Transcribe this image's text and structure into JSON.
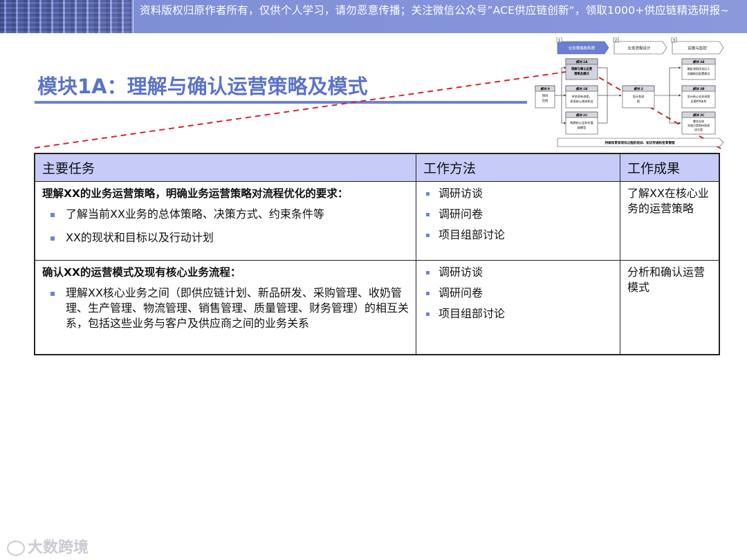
{
  "banner": {
    "notice": "资料版权归原作者所有，仅供个人学习，请勿恶意传播；关注微信公众号”ACE供应链创新“，领取1000+供应链精选研报~"
  },
  "title": "模块1A：理解与确认运营策略及模式",
  "diagram": {
    "phases": [
      {
        "num": "1",
        "label": "业务策略和构想"
      },
      {
        "num": "2",
        "label": "业务流程设计"
      },
      {
        "num": "3",
        "label": "实施与监控"
      }
    ],
    "m0": {
      "title": "模块 0",
      "text": "项目\n启动"
    },
    "m1a": {
      "title": "模块 1A",
      "text": "理解与确认运营\n策略及模式"
    },
    "m1b": {
      "title": "模块 1B",
      "text": "评估现有流程，\n发现核心改进机会"
    },
    "m1c": {
      "title": "模块 1C",
      "text": "构建核心业务价值\n链模型"
    },
    "m2": {
      "title": "模块 2",
      "text": "设计各流\n程"
    },
    "m3a": {
      "title": "模块 3A",
      "text": "确定流程优化后人\n员编制及配置建议"
    },
    "m3b": {
      "title": "模块 3B",
      "text": "设计核心业务流程\n运营KPI体系"
    },
    "m3c": {
      "title": "模块 3C",
      "text": "整合总体\n实施方案和持续改\n进方案"
    },
    "footer": "持续和贯穿项目过程的培训、知识传递和变革管理"
  },
  "table": {
    "headers": [
      "主要任务",
      "工作方法",
      "工作成果"
    ],
    "rows": [
      {
        "task_head": "理解XX的业务运营策略，明确业务运营策略对流程优化的要求：",
        "bullets": [
          "了解当前XX业务的总体策略、决策方式、约束条件等",
          "XX的现状和目标以及行动计划"
        ],
        "methods": [
          "调研访谈",
          "调研问卷",
          "项目组部讨论"
        ],
        "result": "了解XX在核心业务的运营策略"
      },
      {
        "task_head": "确认XX的运营模式及现有核心业务流程：",
        "bullets": [
          "理解XX核心业务之间（即供应链计划、新品研发、采购管理、收奶管理、生产管理、物流管理、销售管理、质量管理、财务管理）的相互关系，包括这些业务与客户及供应商之间的业务关系"
        ],
        "methods": [
          "调研访谈",
          "调研问卷",
          "项目组部讨论"
        ],
        "result": "分析和确认运营模式"
      }
    ]
  },
  "logo": "大数跨境",
  "colors": {
    "accent": "#5b73c9",
    "header_fill": "#c6cbf7",
    "dash": "#d9232b"
  }
}
